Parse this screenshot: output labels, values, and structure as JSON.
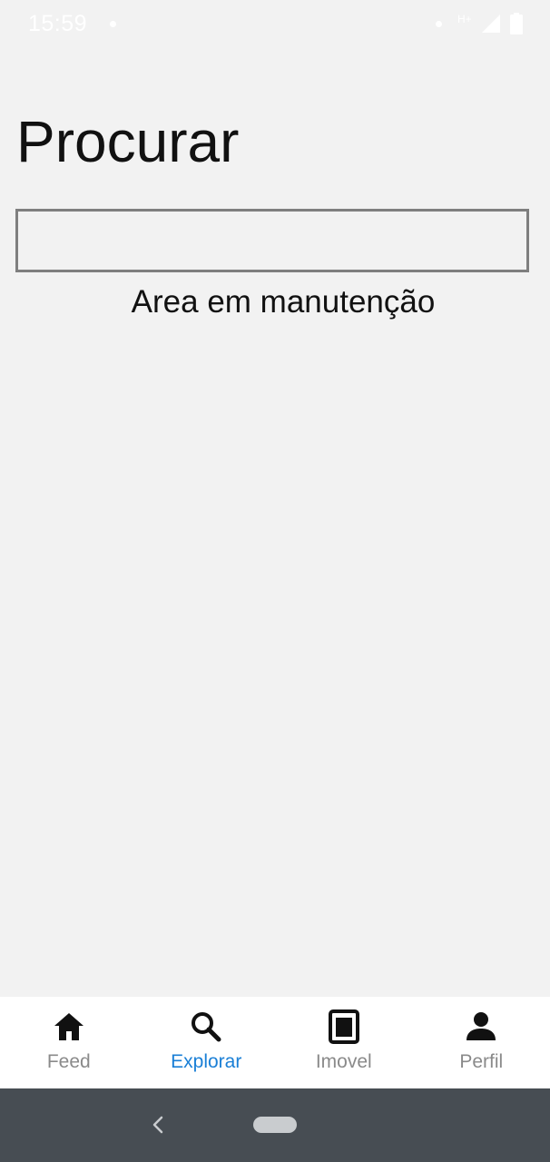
{
  "status_bar": {
    "time": "15:59",
    "network_label": "H+"
  },
  "header": {
    "title": "Procurar"
  },
  "search": {
    "value": "",
    "placeholder": ""
  },
  "content": {
    "maintenance_message": "Area em manutenção"
  },
  "bottom_nav": {
    "items": [
      {
        "label": "Feed",
        "icon": "home-icon",
        "active": false
      },
      {
        "label": "Explorar",
        "icon": "search-icon",
        "active": true
      },
      {
        "label": "Imovel",
        "icon": "document-icon",
        "active": false
      },
      {
        "label": "Perfil",
        "icon": "person-icon",
        "active": false
      }
    ]
  },
  "colors": {
    "background": "#f2f2f2",
    "accent": "#1a7fd6",
    "inactive_label": "#8a8a8a",
    "system_nav": "#474d53"
  }
}
